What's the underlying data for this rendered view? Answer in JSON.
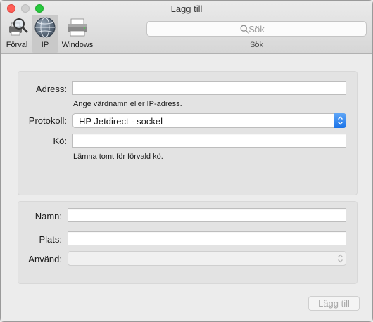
{
  "window": {
    "title": "Lägg till"
  },
  "toolbar": {
    "items": [
      {
        "label": "Förval",
        "icon": "default-printer-icon",
        "selected": false
      },
      {
        "label": "IP",
        "icon": "globe-icon",
        "selected": true
      },
      {
        "label": "Windows",
        "icon": "windows-printer-icon",
        "selected": false
      }
    ],
    "search": {
      "placeholder": "Sök",
      "value": "",
      "caption": "Sök"
    }
  },
  "form": {
    "address": {
      "label": "Adress:",
      "value": "",
      "hint": "Ange värdnamn eller IP-adress."
    },
    "protocol": {
      "label": "Protokoll:",
      "value": "HP Jetdirect - sockel"
    },
    "queue": {
      "label": "Kö:",
      "value": "",
      "hint": "Lämna tomt för förvald kö."
    },
    "name": {
      "label": "Namn:",
      "value": ""
    },
    "location": {
      "label": "Plats:",
      "value": ""
    },
    "use": {
      "label": "Använd:",
      "value": "",
      "enabled": false
    }
  },
  "actions": {
    "add_label": "Lägg till",
    "add_enabled": false
  },
  "colors": {
    "accent": "#1a73e8",
    "close": "#ff5f57",
    "zoom": "#27c93f"
  }
}
